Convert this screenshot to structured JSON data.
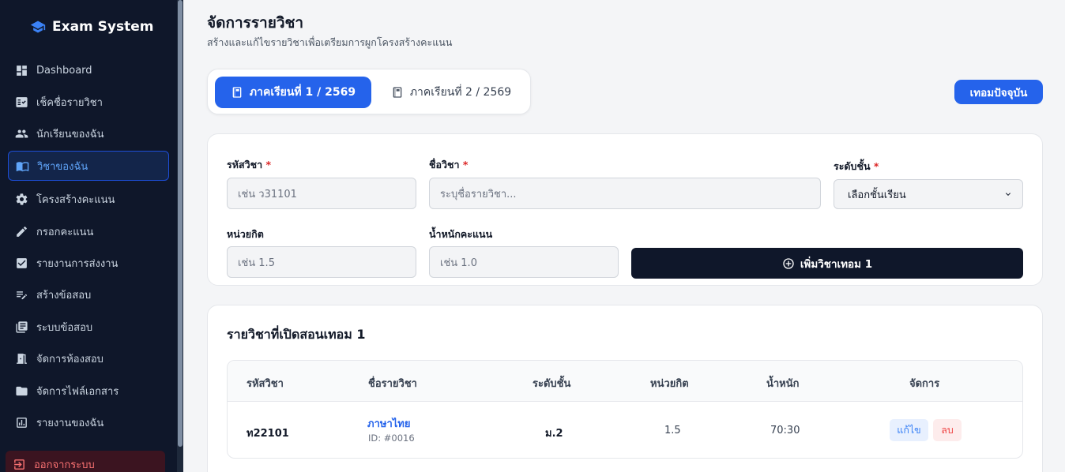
{
  "brand": {
    "name": "Exam System"
  },
  "sidebar": {
    "items": [
      {
        "label": "Dashboard",
        "icon": "dashboard-icon"
      },
      {
        "label": "เช็คชื่อรายวิชา",
        "icon": "checklist-icon"
      },
      {
        "label": "นักเรียนของฉัน",
        "icon": "people-icon"
      },
      {
        "label": "วิชาของฉัน",
        "icon": "book-icon",
        "active": true
      },
      {
        "label": "โครงสร้างคะแนน",
        "icon": "gear-icon"
      },
      {
        "label": "กรอกคะแนน",
        "icon": "pencil-icon"
      },
      {
        "label": "รายงานการส่งงาน",
        "icon": "check-box-icon"
      },
      {
        "label": "สร้างข้อสอบ",
        "icon": "edit-note-icon"
      },
      {
        "label": "ระบบข้อสอบ",
        "icon": "library-icon"
      },
      {
        "label": "จัดการห้องสอบ",
        "icon": "door-icon"
      },
      {
        "label": "จัดการไฟล์เอกสาร",
        "icon": "folder-icon"
      },
      {
        "label": "รายงานของฉัน",
        "icon": "report-icon"
      }
    ],
    "logout": "ออกจากระบบ"
  },
  "header": {
    "title": "จัดการรายวิชา",
    "subtitle": "สร้างและแก้ไขรายวิชาเพื่อเตรียมการผูกโครงสร้างคะแนน"
  },
  "terms": {
    "tab1": "ภาคเรียนที่ 1 / 2569",
    "tab2": "ภาคเรียนที่ 2 / 2569",
    "current_button": "เทอมปัจจุบัน"
  },
  "form": {
    "code_label": "รหัสวิชา",
    "code_placeholder": "เช่น ว31101",
    "name_label": "ชื่อวิชา",
    "name_placeholder": "ระบุชื่อรายวิชา...",
    "level_label": "ระดับชั้น",
    "level_selected": "เลือกชั้นเรียน",
    "credit_label": "หน่วยกิต",
    "credit_placeholder": "เช่น 1.5",
    "weight_label": "น้ำหนักคะแนน",
    "weight_placeholder": "เช่น 1.0",
    "required_mark": "*",
    "add_button": "เพิ่มวิชาเทอม 1"
  },
  "list": {
    "title": "รายวิชาที่เปิดสอนเทอม 1",
    "columns": [
      "รหัสวิชา",
      "ชื่อรายวิชา",
      "ระดับชั้น",
      "หน่วยกิต",
      "น้ำหนัก",
      "จัดการ"
    ],
    "rows": [
      {
        "code": "ท22101",
        "name": "ภาษาไทย",
        "id": "ID: #0016",
        "level": "ม.2",
        "credit": "1.5",
        "weight": "70:30",
        "edit": "แก้ไข",
        "delete": "ลบ"
      }
    ]
  },
  "colors": {
    "accent": "#2563eb",
    "sidebar": "#0f172a",
    "danger": "#ef4444"
  }
}
